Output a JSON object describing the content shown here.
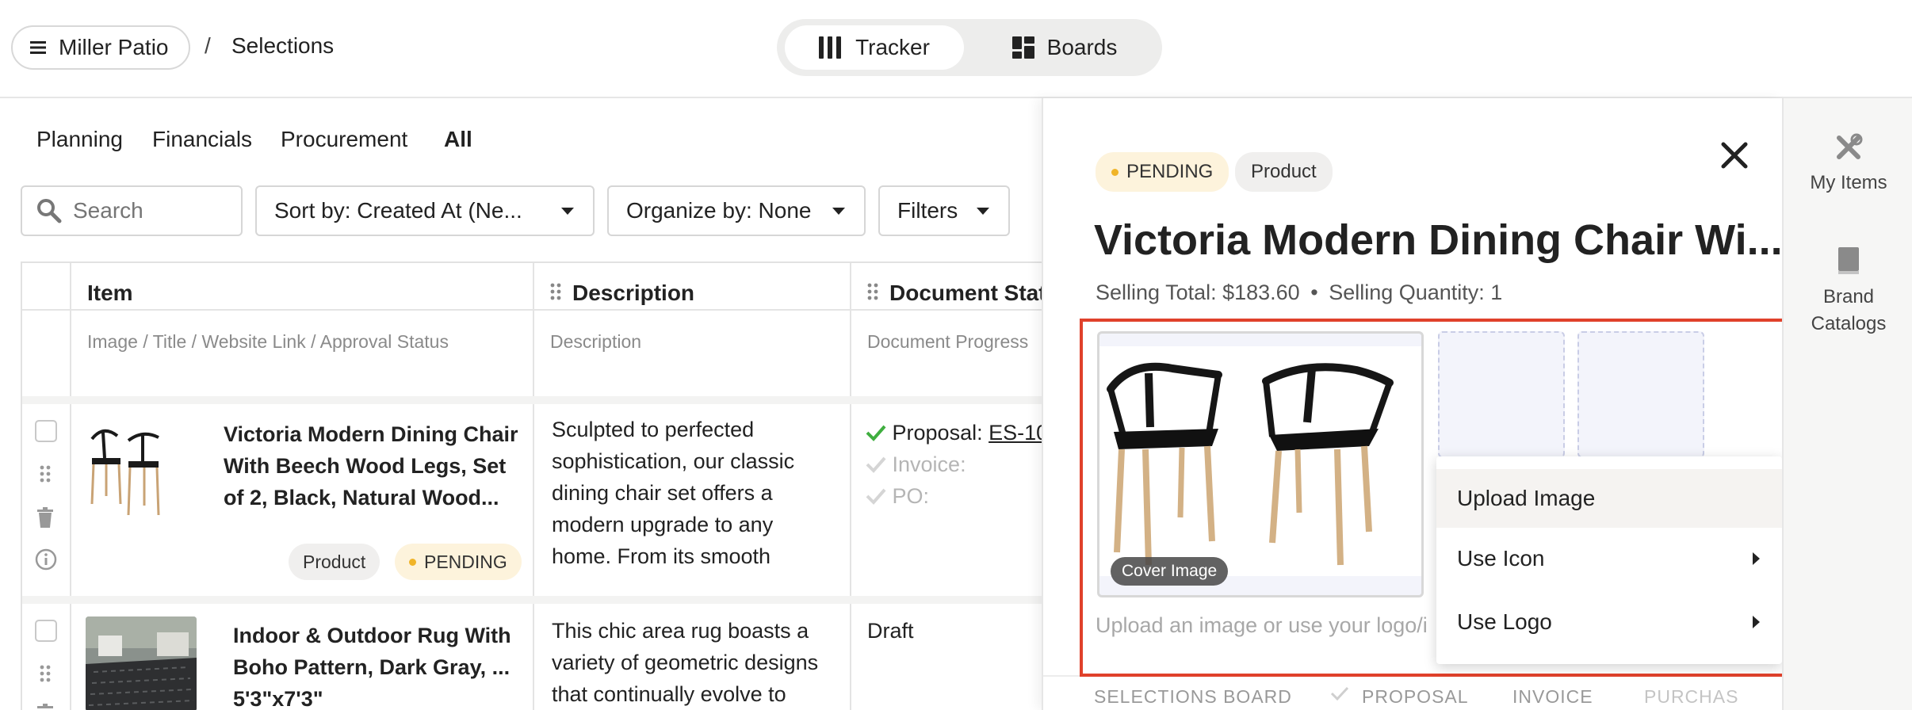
{
  "header": {
    "project_name": "Miller Patio",
    "breadcrumb_sep": "/",
    "breadcrumb_current": "Selections",
    "views": {
      "tracker": "Tracker",
      "boards": "Boards"
    }
  },
  "nav_tabs": [
    "Planning",
    "Financials",
    "Procurement",
    "All"
  ],
  "toolbar": {
    "search_placeholder": "Search",
    "sort_label": "Sort by: Created At (Ne...",
    "organize_label": "Organize by: None",
    "filters_label": "Filters"
  },
  "table": {
    "columns": [
      {
        "title": "Item",
        "sub": "Image / Title / Website Link / Approval Status"
      },
      {
        "title": "Description",
        "sub": "Description"
      },
      {
        "title": "Document Stat",
        "sub": "Document Progress"
      }
    ],
    "rows": [
      {
        "title_lines": [
          "Victoria Modern Dining Chair",
          "With Beech Wood Legs, Set",
          "of 2, Black, Natural Wood..."
        ],
        "desc_lines": [
          "Sculpted to perfected",
          "sophistication, our classic",
          "dining chair set offers a",
          "modern upgrade to any",
          "home. From its smooth"
        ],
        "badge_type": "Product",
        "badge_status": "PENDING",
        "docs": {
          "proposal_label": "Proposal:",
          "proposal_ref": "ES-10",
          "invoice_label": "Invoice:",
          "po_label": "PO:"
        }
      },
      {
        "title_lines": [
          "Indoor & Outdoor Rug With",
          "Boho Pattern, Dark Gray, ...",
          "5'3\"x7'3\""
        ],
        "desc_lines": [
          "This chic area rug boasts a",
          "variety of geometric designs",
          "that continually evolve to"
        ],
        "doc_status": "Draft"
      }
    ]
  },
  "panel": {
    "status_badge": "PENDING",
    "type_badge": "Product",
    "title": "Victoria Modern Dining Chair Wi...",
    "selling_total": "Selling Total: $183.60",
    "bullet": "•",
    "selling_qty": "Selling Quantity: 1",
    "cover_label": "Cover Image",
    "upload_hint": "Upload an image or use your logo/i",
    "menu": {
      "upload": "Upload Image",
      "icon": "Use Icon",
      "logo": "Use Logo"
    },
    "bottom_tabs": [
      "SELECTIONS BOARD",
      "PROPOSAL",
      "INVOICE",
      "PURCHAS"
    ]
  },
  "rail": {
    "my_items": "My Items",
    "brand_line1": "Brand",
    "brand_line2": "Catalogs"
  },
  "colors": {
    "accent_red": "#e0412b",
    "pending_dot": "#f0b428",
    "check_green": "#3fae3f"
  }
}
